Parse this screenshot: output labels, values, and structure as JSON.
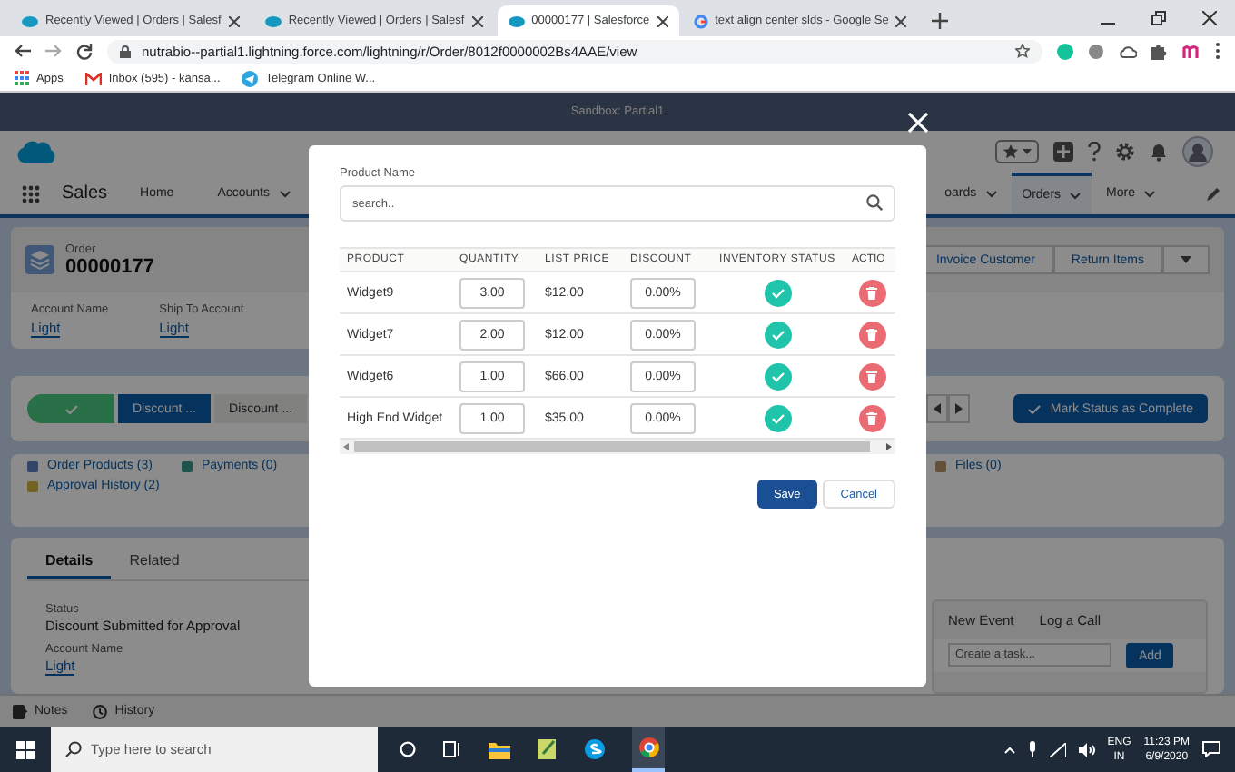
{
  "browser": {
    "tabs": [
      {
        "title": "Recently Viewed | Orders | Salesf",
        "kind": "cloud",
        "selected": false
      },
      {
        "title": "Recently Viewed | Orders | Salesf",
        "kind": "cloud",
        "selected": false
      },
      {
        "title": "00000177 | Salesforce",
        "kind": "cloud",
        "selected": true
      },
      {
        "title": "text align center slds - Google Se",
        "kind": "google",
        "selected": false
      }
    ],
    "url": "nutrabio--partial1.lightning.force.com/lightning/r/Order/8012f0000002Bs4AAE/view",
    "bookmarks": [
      {
        "label": "Apps",
        "kind": "grid"
      },
      {
        "label": "Inbox (595) - kansa...",
        "kind": "mail"
      },
      {
        "label": "Telegram Online W...",
        "kind": "telegram"
      }
    ]
  },
  "app": {
    "sandbox_banner": "Sandbox: Partial1",
    "app_name": "Sales",
    "nav_left": [
      {
        "label": "Home",
        "dropdown": false,
        "selected": false
      },
      {
        "label": "Accounts",
        "dropdown": true,
        "selected": false
      }
    ],
    "nav_right": [
      {
        "label": "oards",
        "dropdown": true,
        "selected": false
      },
      {
        "label": "Orders",
        "dropdown": true,
        "selected": true
      },
      {
        "label": "More",
        "dropdown": true,
        "selected": false
      }
    ],
    "record": {
      "object": "Order",
      "number": "00000177",
      "actions": [
        "Invoice Customer",
        "Return Items"
      ],
      "fields": [
        {
          "label": "Account Name",
          "value": "Light"
        },
        {
          "label": "Ship To Account",
          "value": "Light"
        }
      ]
    },
    "path": {
      "steps": [
        {
          "kind": "complete"
        },
        {
          "kind": "current",
          "label": "Discount ..."
        },
        {
          "kind": "upcoming",
          "label": "Discount ..."
        }
      ],
      "complete_button": "Mark Status as Complete"
    },
    "related_links": [
      {
        "label": "Order Products (3)",
        "kind": "products"
      },
      {
        "label": "Payments (0)",
        "kind": "payments"
      },
      {
        "label": "Approval History (2)",
        "kind": "approval"
      }
    ],
    "related_links_right": [
      {
        "label": "Files (0)",
        "kind": "files"
      }
    ],
    "detail_tabs": [
      {
        "label": "Details",
        "selected": true
      },
      {
        "label": "Related",
        "selected": false
      }
    ],
    "detail_fields": [
      {
        "label": "Status",
        "value": "Discount Submitted for Approval",
        "kind": "text"
      },
      {
        "label": "Account Name",
        "value": "Light",
        "kind": "link"
      }
    ],
    "activity": {
      "tabs": [
        "New Event",
        "Log a Call"
      ],
      "placeholder": "Create a task...",
      "button": "Add"
    },
    "utility_bar": [
      {
        "label": "Notes",
        "kind": "notes"
      },
      {
        "label": "History",
        "kind": "clock"
      }
    ]
  },
  "modal": {
    "search_label": "Product Name",
    "search_placeholder": "search..",
    "columns": [
      "PRODUCT",
      "QUANTITY",
      "LIST PRICE",
      "DISCOUNT",
      "INVENTORY STATUS",
      "ACTIO"
    ],
    "rows": [
      {
        "product": "Widget9",
        "quantity": "3.00",
        "list_price": "$12.00",
        "discount": "0.00%"
      },
      {
        "product": "Widget7",
        "quantity": "2.00",
        "list_price": "$12.00",
        "discount": "0.00%"
      },
      {
        "product": "Widget6",
        "quantity": "1.00",
        "list_price": "$66.00",
        "discount": "0.00%"
      },
      {
        "product": "High End Widget",
        "quantity": "1.00",
        "list_price": "$35.00",
        "discount": "0.00%"
      }
    ],
    "save": "Save",
    "cancel": "Cancel"
  },
  "taskbar": {
    "search_placeholder": "Type here to search",
    "language": "ENG",
    "region": "IN",
    "time": "11:23 PM",
    "date": "6/9/2020"
  }
}
